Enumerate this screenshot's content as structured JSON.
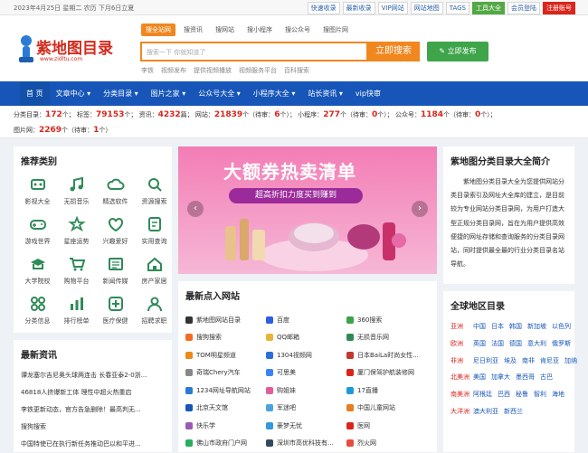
{
  "topbar": {
    "date": "2023年4月25日 星期二 农历 下月6日立夏",
    "links": [
      "快速收录",
      "最新收录",
      "VIP网站",
      "网站地图",
      "TAGS",
      "工具大全",
      "会员登陆",
      "注册账号"
    ]
  },
  "header": {
    "logo_text": "紫地图目录",
    "logo_url": "www.zidltu.com",
    "search_tabs": [
      "搜全站网",
      "搜资讯",
      "搜网站",
      "搜小程序",
      "搜公众号",
      "搜图片网"
    ],
    "search_placeholder": "搜索一下 你就知道了",
    "search_button": "立即搜索",
    "publish_button": "立即发布",
    "hot_links": [
      "李铁",
      "视频发布",
      "提供视频播放",
      "视频服务平台",
      "百科搜索"
    ]
  },
  "nav": {
    "items": [
      "首 页",
      "文章中心 ▾",
      "分类目录 ▾",
      "图片之家 ▾",
      "公众号大全 ▾",
      "小程序大全 ▾",
      "站长资讯 ▾",
      "vip快审"
    ]
  },
  "stats": {
    "line1": [
      {
        "label": "分类目录：",
        "value": "172",
        "unit": "个；"
      },
      {
        "label": "标签：",
        "value": "79153",
        "unit": "个；"
      },
      {
        "label": "资讯：",
        "value": "4232",
        "unit": "篇；"
      },
      {
        "label": "网站：",
        "value": "21839",
        "unit": "个（待审："
      },
      {
        "label": "",
        "value": "6",
        "unit": "个）；"
      },
      {
        "label": "小程序：",
        "value": "277",
        "unit": "个（待审："
      },
      {
        "label": "",
        "value": "0",
        "unit": "个）；"
      },
      {
        "label": "公众号：",
        "value": "1184",
        "unit": "个（待审："
      },
      {
        "label": "",
        "value": "0",
        "unit": "个）；"
      }
    ],
    "line2": [
      {
        "label": "图片网：",
        "value": "2269",
        "unit": "个（待审："
      },
      {
        "label": "",
        "value": "1",
        "unit": "个）"
      }
    ]
  },
  "recommend": {
    "title": "推荐类别",
    "items": [
      {
        "label": "影视大全",
        "icon": "film-icon"
      },
      {
        "label": "无损音乐",
        "icon": "music-icon"
      },
      {
        "label": "精选软件",
        "icon": "cloud-icon"
      },
      {
        "label": "资源搜索",
        "icon": "search-icon"
      },
      {
        "label": "游戏世界",
        "icon": "gamepad-icon"
      },
      {
        "label": "星座运势",
        "icon": "star-icon"
      },
      {
        "label": "兴趣爱好",
        "icon": "heart-icon"
      },
      {
        "label": "实用查询",
        "icon": "query-icon"
      },
      {
        "label": "大学院校",
        "icon": "school-icon"
      },
      {
        "label": "购物平台",
        "icon": "cart-icon"
      },
      {
        "label": "新闻传媒",
        "icon": "news-icon"
      },
      {
        "label": "房产家居",
        "icon": "house-icon"
      },
      {
        "label": "分类信息",
        "icon": "grid-icon"
      },
      {
        "label": "排行榜单",
        "icon": "rank-icon"
      },
      {
        "label": "医疗保健",
        "icon": "medical-icon"
      },
      {
        "label": "招聘求职",
        "icon": "job-icon"
      }
    ]
  },
  "latest_news": {
    "title": "最新资讯",
    "items": [
      "谭龙塞尔吉尼奥头球两连击 长春亚泰2-0浙...",
      "46818人挤爆新工体 理性中超火热重启",
      "李铁更新动态，官方告急删除！最高判无...",
      "搜狗搜索",
      "中国特使已在执行新任务推动巴以和平进..."
    ]
  },
  "banner": {
    "title": "大额券热卖清单",
    "subtitle": "超高折扣力度买到赚到"
  },
  "latest_sites": {
    "title": "最新点入网站",
    "items": [
      {
        "name": "紫地图网站目录",
        "color": "#333333"
      },
      {
        "name": "百度",
        "color": "#2d5fe0"
      },
      {
        "name": "360搜索",
        "color": "#3da24a"
      },
      {
        "name": "搜狗搜索",
        "color": "#f36c21"
      },
      {
        "name": "QQ邮箱",
        "color": "#e9b43a"
      },
      {
        "name": "无损音乐网",
        "color": "#2e8b57"
      },
      {
        "name": "TOM明星频道",
        "color": "#e98a1b"
      },
      {
        "name": "1304视频网",
        "color": "#2b6fd6"
      },
      {
        "name": "日本BaiLa时尚女性...",
        "color": "#c0392b"
      },
      {
        "name": "奇瑞Chery汽车",
        "color": "#888888"
      },
      {
        "name": "可思美",
        "color": "#3b82f6"
      },
      {
        "name": "厦门保驾护航装修网",
        "color": "#d9251c"
      },
      {
        "name": "1234网址导航网站",
        "color": "#2a7ad6"
      },
      {
        "name": "购姐妹",
        "color": "#e25c9c"
      },
      {
        "name": "17直播",
        "color": "#1d9bd7"
      },
      {
        "name": "北京天文馆",
        "color": "#1756b8"
      },
      {
        "name": "军迷吧",
        "color": "#4aa3df"
      },
      {
        "name": "中国儿童网站",
        "color": "#e67e22"
      },
      {
        "name": "快乐学",
        "color": "#9b59b6"
      },
      {
        "name": "豪梦无忧",
        "color": "#3498db"
      },
      {
        "name": "医网",
        "color": "#d9251c"
      },
      {
        "name": "佛山市政府门户网",
        "color": "#27ae60"
      },
      {
        "name": "深圳市高优科技有...",
        "color": "#34495e"
      },
      {
        "name": "烈火网",
        "color": "#e74c3c"
      }
    ]
  },
  "intro": {
    "title": "紫地图分类目录大全简介",
    "text": "紫地图分类目录大全为您提供网站分类目录索引及网址大全库的建立，是目前较为专业网站分类目录网，为用户打造大型正规分类目录网，旨在为用户提供高效便捷的网址存储和查询服务的分类目录网站，同时提供最全最的行业分类目录名站导航。"
  },
  "regions": {
    "title": "全球地区目录",
    "rows": [
      {
        "name": "亚洲",
        "items": [
          "中国",
          "日本",
          "韩国",
          "新加坡",
          "以色列"
        ]
      },
      {
        "name": "欧洲",
        "items": [
          "英国",
          "法国",
          "德国",
          "意大利",
          "俄罗斯"
        ]
      },
      {
        "name": "非洲",
        "items": [
          "尼日利亚",
          "埃及",
          "南非",
          "肯尼亚",
          "加纳"
        ]
      },
      {
        "name": "北美洲",
        "items": [
          "美国",
          "加拿大",
          "墨西哥",
          "古巴"
        ]
      },
      {
        "name": "南美洲",
        "items": [
          "阿根廷",
          "巴西",
          "秘鲁",
          "智利",
          "海地"
        ]
      },
      {
        "name": "大洋洲",
        "items": [
          "澳大利亚",
          "新西兰"
        ]
      }
    ]
  },
  "colors": {
    "brand": "#d32b1e",
    "nav": "#1756b8",
    "search_accent": "#f0871f",
    "icon_green": "#2e8b57",
    "publish_green": "#3ea54b"
  }
}
